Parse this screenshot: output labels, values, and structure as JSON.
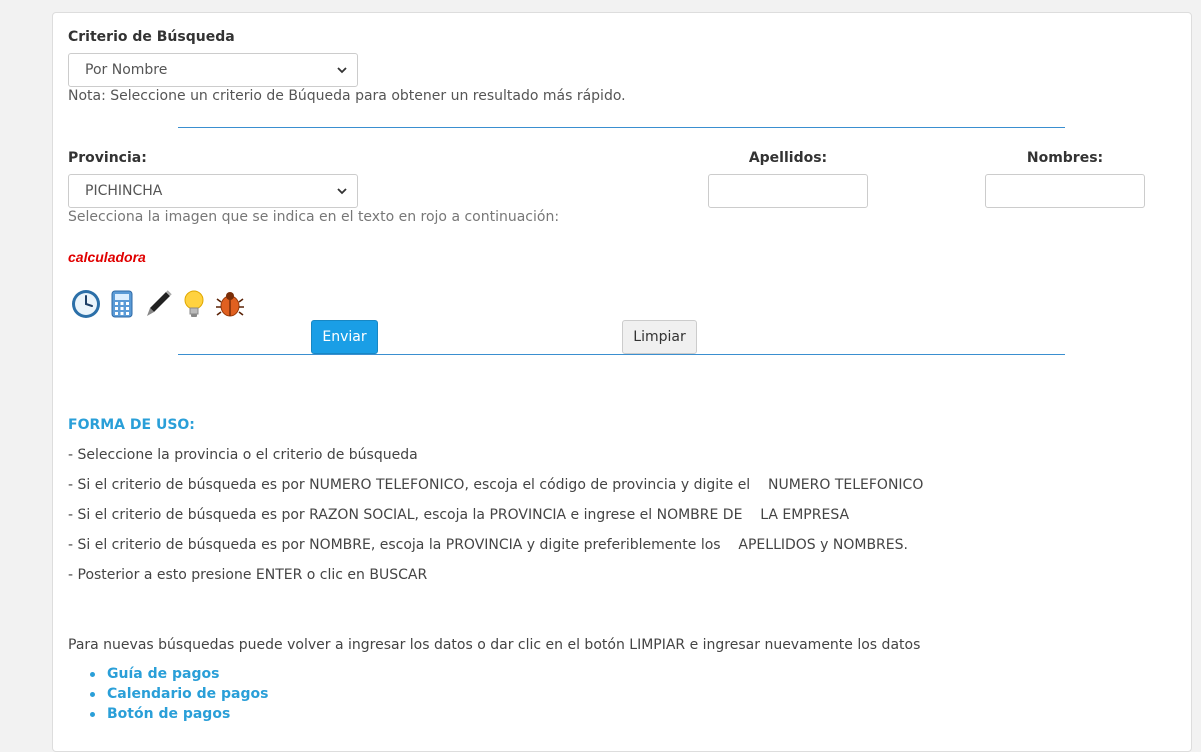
{
  "search_criteria": {
    "label": "Criterio de Búsqueda",
    "selected": "Por Nombre",
    "note": "Nota: Seleccione un criterio de Búqueda para obtener un resultado más rápido."
  },
  "form": {
    "province_label": "Provincia:",
    "province_selected": "PICHINCHA",
    "surnames_label": "Apellidos:",
    "surnames_value": "",
    "names_label": "Nombres:",
    "names_value": ""
  },
  "captcha": {
    "instruction": "Selecciona la imagen que se indica en el texto en rojo a continuación:",
    "target_word": "calculadora",
    "icons": [
      "clock-icon",
      "calculator-icon",
      "pen-icon",
      "lightbulb-icon",
      "bug-icon"
    ]
  },
  "buttons": {
    "submit": "Enviar",
    "clear": "Limpiar"
  },
  "usage": {
    "title": "FORMA DE USO:",
    "steps": [
      "- Seleccione la provincia o el criterio de búsqueda",
      "- Si el criterio de búsqueda es por NUMERO TELEFONICO, escoja el código de provincia y digite el    NUMERO TELEFONICO",
      "- Si el criterio de búsqueda es por RAZON SOCIAL, escoja la PROVINCIA e ingrese el NOMBRE DE    LA EMPRESA",
      "- Si el criterio de búsqueda es por NOMBRE, escoja la PROVINCIA y digite preferiblemente los    APELLIDOS y NOMBRES.",
      "- Posterior a esto presione ENTER o clic en BUSCAR"
    ],
    "footer": "Para nuevas búsquedas puede volver a ingresar los datos o dar clic en el botón LIMPIAR e ingresar nuevamente los datos"
  },
  "links": [
    "Guía de pagos",
    "Calendario de pagos",
    "Botón de pagos"
  ],
  "colors": {
    "accent": "#1a9ee6",
    "link": "#2a9fd8",
    "captcha_word": "#e00000",
    "divider": "#3a8fd0"
  }
}
